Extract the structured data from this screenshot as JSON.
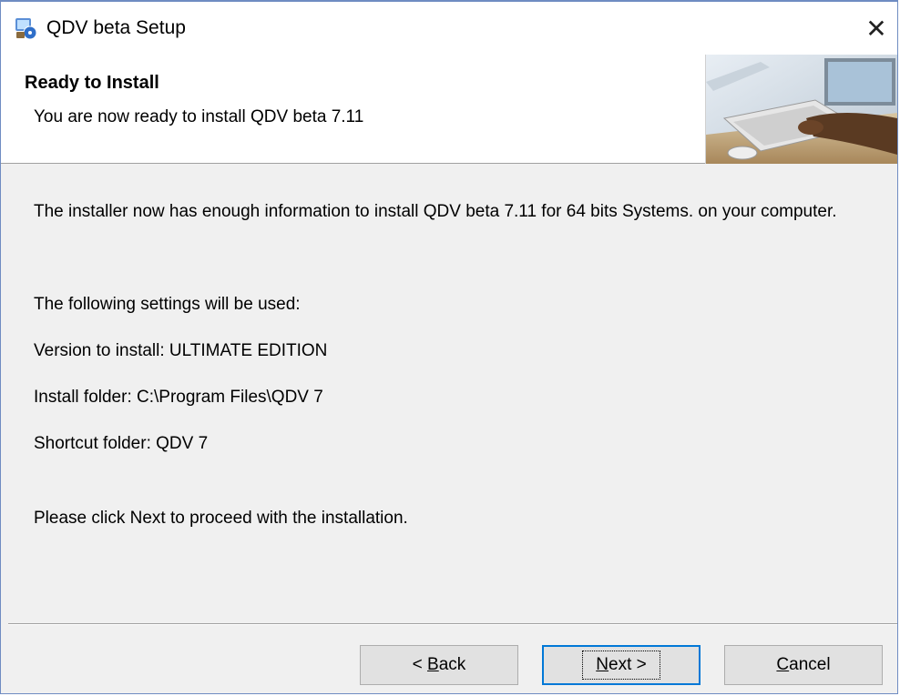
{
  "window": {
    "title": "QDV beta Setup",
    "close_glyph": "✕"
  },
  "header": {
    "title": "Ready to Install",
    "subtitle": "You are now ready to install QDV beta 7.11",
    "banner_icon": "computer-keyboard-photo"
  },
  "content": {
    "intro": "The installer now has enough information to install QDV beta 7.11 for 64 bits Systems. on your computer.",
    "settings_heading": "The following settings will be used:",
    "version_line": "Version to install: ULTIMATE EDITION",
    "folder_line": "Install folder: C:\\Program Files\\QDV 7",
    "shortcut_line": "Shortcut folder: QDV 7",
    "proceed": "Please click Next to proceed with the installation."
  },
  "buttons": {
    "back": {
      "prefix": "< ",
      "mnemonic": "B",
      "rest": "ack"
    },
    "next": {
      "prefix": "",
      "mnemonic": "N",
      "rest": "ext >"
    },
    "cancel": {
      "prefix": "",
      "mnemonic": "C",
      "rest": "ancel"
    }
  },
  "colors": {
    "accent": "#0078d7",
    "window_border": "#6f8cc2",
    "dialog_bg": "#f0f0f0"
  }
}
